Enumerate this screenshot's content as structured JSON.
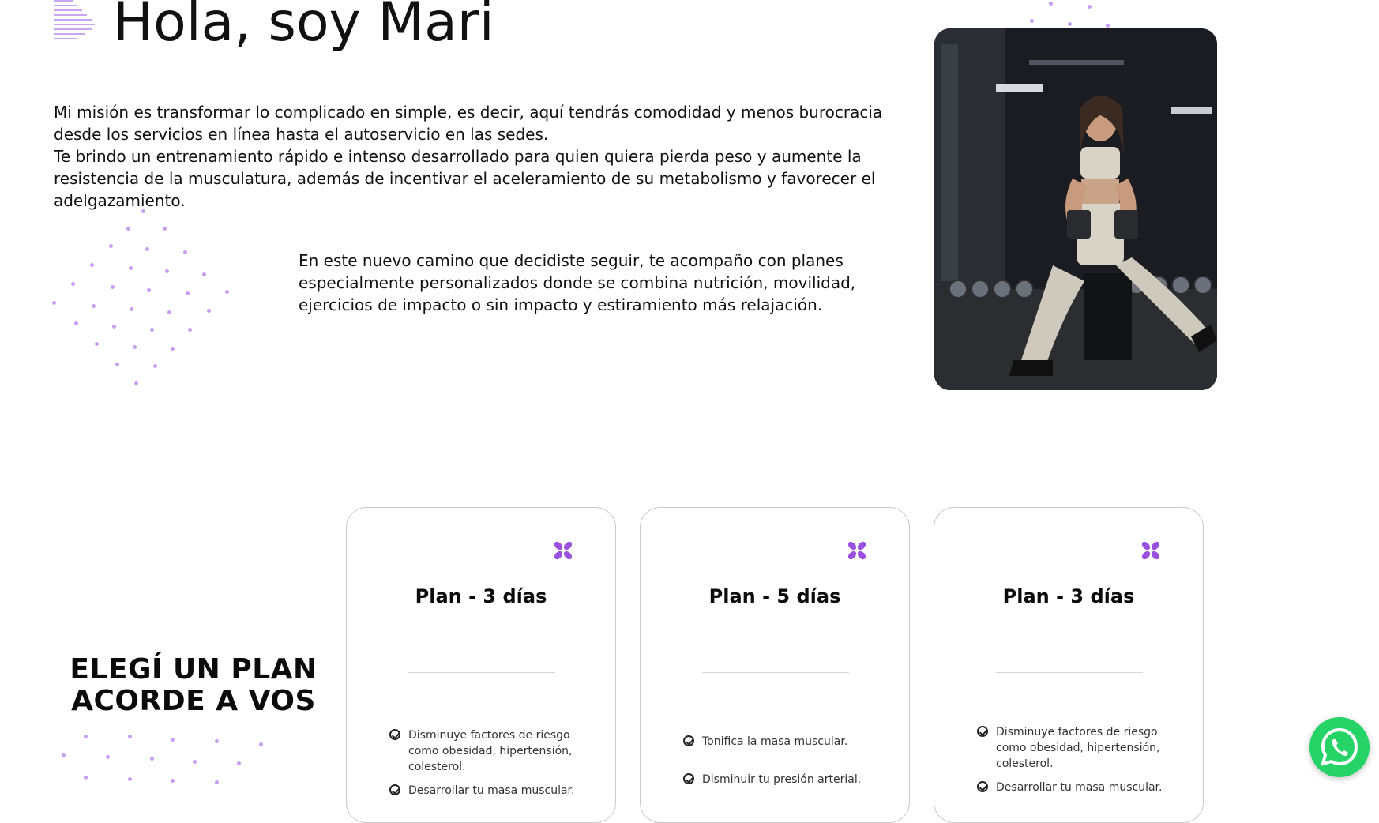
{
  "hero": {
    "title": "Hola, soy Mari",
    "paragraph1": "Mi misión es transformar lo complicado en simple, es decir, aquí tendrás comodidad y menos burocracia desde los servicios en línea hasta el autoservicio en las sedes.\nTe brindo un entrenamiento rápido e intenso desarrollado para quien quiera pierda peso y aumente la resistencia de la musculatura, además de incentivar el aceleramiento de su metabolismo y favorecer el adelgazamiento.",
    "paragraph2": "En este nuevo camino que decidiste seguir, te acompaño con planes especialmente personalizados donde se combina nutrición, movilidad, ejercicios de impacto o sin impacto y estiramiento más relajación."
  },
  "plans_section": {
    "heading_line1": "ELEGÍ UN PLAN",
    "heading_line2": "ACORDE A VOS"
  },
  "plans": [
    {
      "title": "Plan - 3 días",
      "features": [
        "Disminuye factores de riesgo como obesidad, hipertensión, colesterol.",
        "Desarrollar tu masa muscular."
      ]
    },
    {
      "title": "Plan - 5 días",
      "features": [
        "Tonifica la masa muscular.",
        "Disminuir tu presión arterial."
      ]
    },
    {
      "title": "Plan - 3 días",
      "features": [
        "Disminuye factores de riesgo como obesidad, hipertensión, colesterol.",
        "Desarrollar tu masa muscular."
      ]
    }
  ],
  "icons": {
    "flower": "flower-icon",
    "check": "check-circle-icon",
    "whatsapp": "whatsapp-icon"
  },
  "colors": {
    "accent": "#9b51e0",
    "dots": "#c89ef2",
    "whatsapp": "#25d366"
  }
}
